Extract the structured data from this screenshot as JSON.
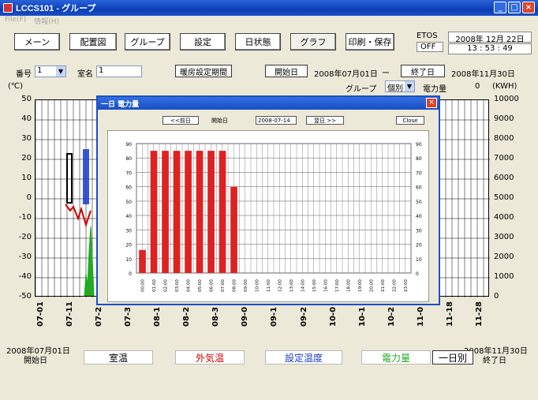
{
  "window": {
    "title": "LCCS101 - グループ"
  },
  "menu": [
    "File(F)",
    "情報(H)"
  ],
  "toolbar": {
    "buttons": [
      "メーン",
      "配置図",
      "グループ",
      "設定",
      "日状態",
      "グラフ",
      "印刷・保存"
    ],
    "etos_label": "ETOS",
    "etos_status": "OFF",
    "date": "2008年 12月 22日",
    "time": "13 : 53 : 49"
  },
  "controls": {
    "number_label": "番号",
    "number_value": "1",
    "room_label": "室名",
    "room_value": "1",
    "heating_btn": "暖房設定期間",
    "start_btn": "開始日",
    "start_date": "2008年07月01日",
    "dash": "ー",
    "end_btn": "終了日",
    "end_date": "2008年11月30日",
    "group_label": "グループ",
    "group_value": "個別",
    "power_label": "電力量",
    "power_value": "0",
    "power_unit": "(KWH)"
  },
  "main_chart": {
    "left_unit": "(℃)",
    "left_ticks": [
      "50",
      "40",
      "30",
      "20",
      "10",
      "0",
      "-10",
      "-20",
      "-30",
      "-40",
      "-50"
    ],
    "right_ticks": [
      "10000",
      "9000",
      "8000",
      "7000",
      "6000",
      "5000",
      "4000",
      "3000",
      "2000",
      "1000",
      "0"
    ],
    "x_ticks": [
      "07-01",
      "07-11",
      "07-2",
      "07-3",
      "08-1",
      "08-2",
      "08-3",
      "09-0",
      "09-1",
      "09-2",
      "10-0",
      "10-1",
      "10-2",
      "11-0",
      "11-18",
      "11-28"
    ],
    "start_date": "2008年07月01日",
    "start_label": "開始日",
    "end_date": "2008年11月30日",
    "end_label": "終了日"
  },
  "legend": {
    "room_temp": "室温",
    "outside_temp": "外気温",
    "set_temp": "設定温度",
    "power": "電力量",
    "daily": "一日別",
    "colors": {
      "room": "#000000",
      "outside": "#cc0000",
      "set": "#1a3ccc",
      "power": "#22aa22"
    }
  },
  "popup": {
    "title": "一日 電力量",
    "prev": "<<前日",
    "day_label": "開始日",
    "date_select": "2008-07-14",
    "next": "翌日 >>",
    "close": "Close",
    "bar_color": "#dd2222"
  },
  "chart_data": {
    "type": "bar",
    "title": "",
    "categories": [
      "00:00",
      "01:00",
      "02:00",
      "03:00",
      "04:00",
      "05:00",
      "06:00",
      "07:00",
      "08:00",
      "09:00",
      "10:00",
      "11:00",
      "12:00",
      "13:00",
      "14:00",
      "15:00",
      "16:00",
      "17:00",
      "18:00",
      "19:00",
      "20:00",
      "21:00",
      "22:00",
      "23:00"
    ],
    "values": [
      16,
      85,
      85,
      85,
      85,
      85,
      85,
      85,
      60,
      0,
      0,
      0,
      0,
      0,
      0,
      0,
      0,
      0,
      0,
      0,
      0,
      0,
      0,
      0
    ],
    "ylim": [
      0,
      90
    ],
    "yticks": [
      0,
      10,
      20,
      30,
      40,
      50,
      60,
      70,
      80,
      90
    ],
    "grid": true
  }
}
